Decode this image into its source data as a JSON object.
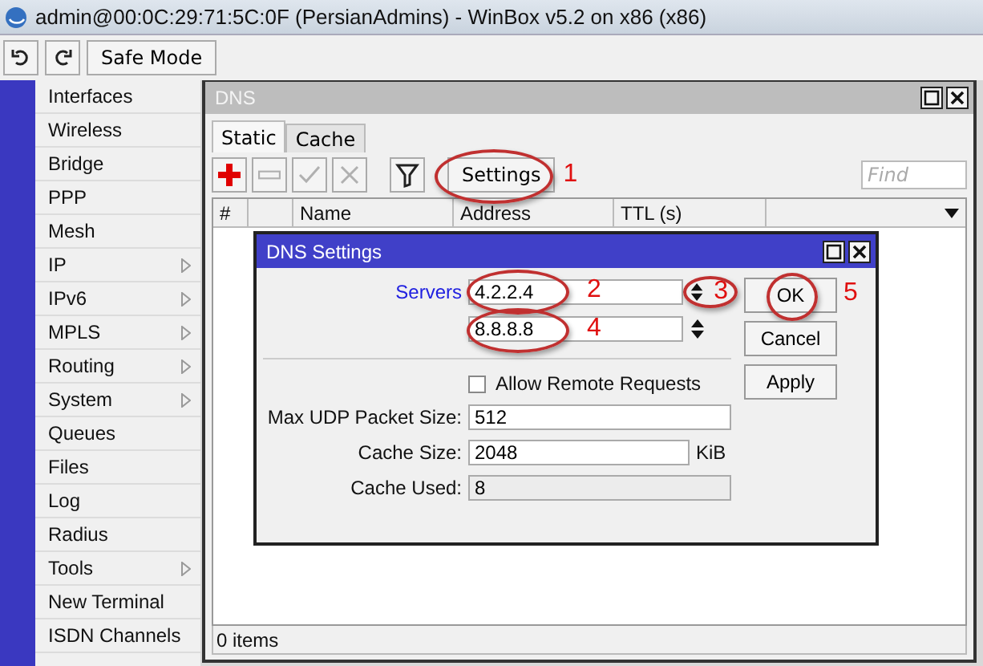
{
  "window": {
    "title": "admin@00:0C:29:71:5C:0F (PersianAdmins) - WinBox v5.2 on x86 (x86)"
  },
  "toolbar": {
    "safe_mode": "Safe Mode"
  },
  "menu": [
    {
      "label": "Interfaces",
      "submenu": false
    },
    {
      "label": "Wireless",
      "submenu": false
    },
    {
      "label": "Bridge",
      "submenu": false
    },
    {
      "label": "PPP",
      "submenu": false
    },
    {
      "label": "Mesh",
      "submenu": false
    },
    {
      "label": "IP",
      "submenu": true
    },
    {
      "label": "IPv6",
      "submenu": true
    },
    {
      "label": "MPLS",
      "submenu": true
    },
    {
      "label": "Routing",
      "submenu": true
    },
    {
      "label": "System",
      "submenu": true
    },
    {
      "label": "Queues",
      "submenu": false
    },
    {
      "label": "Files",
      "submenu": false
    },
    {
      "label": "Log",
      "submenu": false
    },
    {
      "label": "Radius",
      "submenu": false
    },
    {
      "label": "Tools",
      "submenu": true
    },
    {
      "label": "New Terminal",
      "submenu": false
    },
    {
      "label": "ISDN Channels",
      "submenu": false
    }
  ],
  "dns_window": {
    "title": "DNS",
    "tabs": [
      {
        "label": "Static",
        "selected": true
      },
      {
        "label": "Cache",
        "selected": false
      }
    ],
    "tools": [
      {
        "kind": "add",
        "disabled": false
      },
      {
        "kind": "remove",
        "disabled": true
      },
      {
        "kind": "enable",
        "disabled": true
      },
      {
        "kind": "disable",
        "disabled": true
      },
      {
        "kind": "filter",
        "disabled": false
      }
    ],
    "settings_button": "Settings",
    "find_placeholder": "Find",
    "columns": [
      "#",
      "Name",
      "Address",
      "TTL (s)"
    ],
    "status": "0 items"
  },
  "dns_settings": {
    "title": "DNS Settings",
    "servers_label": "Servers",
    "servers": [
      "4.2.2.4",
      "8.8.8.8"
    ],
    "allow_remote_requests": {
      "label": "Allow Remote Requests",
      "checked": false
    },
    "fields": [
      {
        "label": "Max UDP Packet Size:",
        "value": "512",
        "disabled": false
      },
      {
        "label": "Cache Size:",
        "value": "2048",
        "unit": "KiB",
        "disabled": false
      },
      {
        "label": "Cache Used:",
        "value": "8",
        "disabled": true
      }
    ],
    "buttons": [
      "OK",
      "Cancel",
      "Apply"
    ]
  },
  "annotations": [
    "1",
    "2",
    "3",
    "4",
    "5"
  ]
}
